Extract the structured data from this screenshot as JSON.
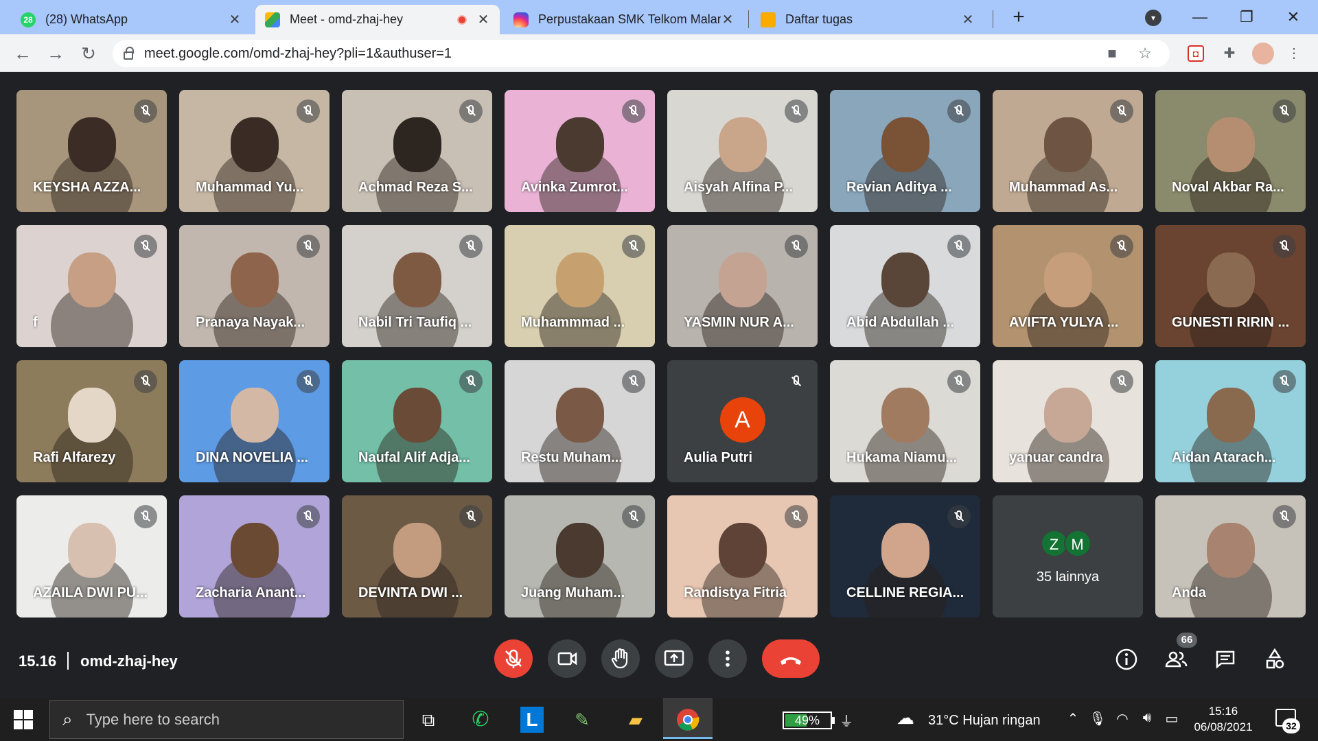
{
  "browser": {
    "tabs": [
      {
        "title": "(28) WhatsApp",
        "favicon": "whatsapp-icon",
        "favicon_text": "28",
        "color": "#25d366"
      },
      {
        "title": "Meet - omd-zhaj-hey",
        "favicon": "google-meet-icon",
        "color": "#00832d"
      },
      {
        "title": "Perpustakaan SMK Telkom Malan",
        "favicon": "instagram-icon",
        "color": "#d6249f"
      },
      {
        "title": "Daftar tugas",
        "favicon": "google-classroom-icon",
        "color": "#f9ab00"
      }
    ],
    "url": "meet.google.com/omd-zhaj-hey?pli=1&authuser=1"
  },
  "meet": {
    "participants": [
      {
        "name": "KEYSHA AZZA...",
        "bg": "#a7957c",
        "skin": "#3b2d26"
      },
      {
        "name": "Muhammad Yu...",
        "bg": "#c6b7a4",
        "skin": "#3a2c24"
      },
      {
        "name": "Achmad Reza S...",
        "bg": "#c9c0b5",
        "skin": "#2d2520"
      },
      {
        "name": "Avinka Zumrot...",
        "bg": "#eab3d6",
        "skin": "#4a3a30"
      },
      {
        "name": "Aisyah Alfina P...",
        "bg": "#d9d7d2",
        "skin": "#c9a58a"
      },
      {
        "name": "Revian Aditya ...",
        "bg": "#8aa6bb",
        "skin": "#7a5236"
      },
      {
        "name": "Muhammad As...",
        "bg": "#bfa992",
        "skin": "#6e5442"
      },
      {
        "name": "Noval Akbar Ra...",
        "bg": "#8a8a6c",
        "skin": "#b58d70"
      },
      {
        "name": "f",
        "bg": "#dcd2d0",
        "skin": "#c69f85"
      },
      {
        "name": "Pranaya Nayak...",
        "bg": "#c1b7ae",
        "skin": "#8e654c"
      },
      {
        "name": "Nabil Tri Taufiq ...",
        "bg": "#d4d1cc",
        "skin": "#7f5a42"
      },
      {
        "name": "Muhammmad ...",
        "bg": "#d8cfb0",
        "skin": "#c7a06f"
      },
      {
        "name": "YASMIN NUR A...",
        "bg": "#b8b3ad",
        "skin": "#c5a393"
      },
      {
        "name": "Abid Abdullah ...",
        "bg": "#d8dadb",
        "skin": "#5a4638"
      },
      {
        "name": "AVIFTA YULYA ...",
        "bg": "#b3936f",
        "skin": "#c79e7c"
      },
      {
        "name": "GUNESTI RIRIN ...",
        "bg": "#6a4430",
        "skin": "#8b6a52"
      },
      {
        "name": "Rafi Alfarezy",
        "bg": "#8d7c5b",
        "skin": "#e4d7c8"
      },
      {
        "name": "DINA NOVELIA ...",
        "bg": "#5d9be4",
        "skin": "#d3b8a6"
      },
      {
        "name": "Naufal Alif Adja...",
        "bg": "#74bfa8",
        "skin": "#6a4b37"
      },
      {
        "name": "Restu Muham...",
        "bg": "#d6d6d6",
        "skin": "#7a5a46"
      },
      {
        "name": "Aulia Putri",
        "letter": "A"
      },
      {
        "name": "Hukama Niamu...",
        "bg": "#dcdad5",
        "skin": "#a17b60"
      },
      {
        "name": "yanuar candra",
        "bg": "#e7e2db",
        "skin": "#c7a896"
      },
      {
        "name": "Aidan Atarach...",
        "bg": "#95d1dc",
        "skin": "#8a6a4e"
      },
      {
        "name": "AZAILA DWI PU...",
        "bg": "#ececea",
        "skin": "#d8c0b0"
      },
      {
        "name": "Zacharia Anant...",
        "bg": "#b0a4d8",
        "skin": "#6b4a33"
      },
      {
        "name": "DEVINTA DWI ...",
        "bg": "#6c5a45",
        "skin": "#c39c80"
      },
      {
        "name": "Juang Muham...",
        "bg": "#b5b7b0",
        "skin": "#4a3a30"
      },
      {
        "name": "Randistya Fitria",
        "bg": "#e7c6b2",
        "skin": "#5e4336"
      },
      {
        "name": "CELLINE REGIA...",
        "bg": "#1f2a3a",
        "skin": "#d0a58c"
      },
      {
        "name": "35 lainnya",
        "more": true,
        "avatars": [
          "Z",
          "M"
        ]
      },
      {
        "name": "Anda",
        "bg": "#c7c2b9",
        "skin": "#a88470"
      }
    ],
    "time": "15.16",
    "meeting_code": "omd-zhaj-hey",
    "participant_count": "66"
  },
  "taskbar": {
    "search_placeholder": "Type here to search",
    "battery": "49%",
    "battery_level": 0.49,
    "weather": "31°C  Hujan ringan",
    "time": "15:16",
    "date": "06/08/2021",
    "notifications": "32"
  }
}
